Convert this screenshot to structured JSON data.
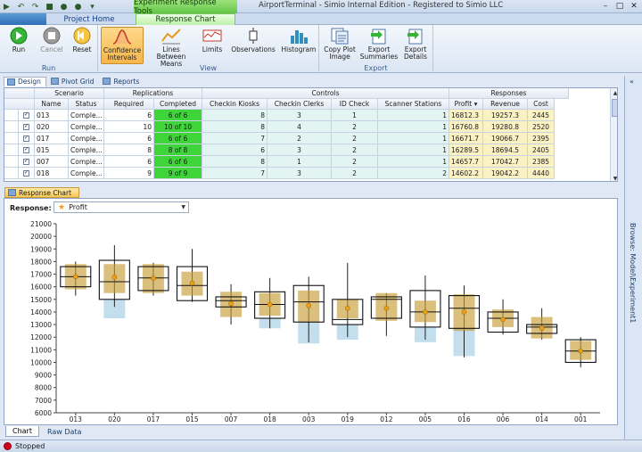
{
  "window": {
    "title": "AirportTerminal - Simio Internal Edition - Registered to Simio LLC",
    "context_tab_group": "Experiment Response Tools",
    "win_buttons": [
      "–",
      "□",
      "✕"
    ]
  },
  "ribbon_tabs": {
    "file": "",
    "project_home": "Project Home",
    "response_chart": "Response Chart"
  },
  "ribbon": {
    "run_group": {
      "label": "Run",
      "run": "Run",
      "cancel": "Cancel",
      "reset": "Reset"
    },
    "view_group": {
      "label": "View",
      "confidence": "Confidence Intervals",
      "lines": "Lines Between Means",
      "limits": "Limits",
      "observations": "Observations",
      "histogram": "Histogram"
    },
    "export_group": {
      "label": "Export",
      "copy_plot": "Copy Plot Image",
      "export_summaries": "Export Summaries",
      "export_details": "Export Details"
    }
  },
  "doc_tabs": {
    "design": "Design",
    "pivot": "Pivot Grid",
    "reports": "Reports"
  },
  "grid": {
    "group_headers": {
      "scenario": "Scenario",
      "replications": "Replications",
      "controls": "Controls",
      "responses": "Responses"
    },
    "columns": {
      "name": "Name",
      "status": "Status",
      "required": "Required",
      "completed": "Completed",
      "kiosks": "Checkin Kiosks",
      "clerks": "Checkin Clerks",
      "id_check": "ID Check",
      "scanner": "Scanner Stations",
      "profit": "Profit",
      "revenue": "Revenue",
      "cost": "Cost"
    },
    "rows": [
      {
        "name": "013",
        "status": "Comple...",
        "required": "6",
        "completed": "6 of 6",
        "kiosks": "8",
        "clerks": "3",
        "id_check": "1",
        "scanner": "1",
        "profit": "16812.3",
        "revenue": "19257.3",
        "cost": "2445"
      },
      {
        "name": "020",
        "status": "Comple...",
        "required": "10",
        "completed": "10 of 10",
        "kiosks": "8",
        "clerks": "4",
        "id_check": "2",
        "scanner": "1",
        "profit": "16760.8",
        "revenue": "19280.8",
        "cost": "2520"
      },
      {
        "name": "017",
        "status": "Comple...",
        "required": "6",
        "completed": "6 of 6",
        "kiosks": "7",
        "clerks": "2",
        "id_check": "2",
        "scanner": "1",
        "profit": "16671.7",
        "revenue": "19066.7",
        "cost": "2395"
      },
      {
        "name": "015",
        "status": "Comple...",
        "required": "8",
        "completed": "8 of 8",
        "kiosks": "6",
        "clerks": "3",
        "id_check": "2",
        "scanner": "1",
        "profit": "16289.5",
        "revenue": "18694.5",
        "cost": "2405"
      },
      {
        "name": "007",
        "status": "Comple...",
        "required": "6",
        "completed": "6 of 6",
        "kiosks": "8",
        "clerks": "1",
        "id_check": "2",
        "scanner": "1",
        "profit": "14657.7",
        "revenue": "17042.7",
        "cost": "2385"
      },
      {
        "name": "018",
        "status": "Comple...",
        "required": "9",
        "completed": "9 of 9",
        "kiosks": "7",
        "clerks": "3",
        "id_check": "2",
        "scanner": "2",
        "profit": "14602.2",
        "revenue": "19042.2",
        "cost": "4440"
      }
    ]
  },
  "chart_panel": {
    "tab": "Response Chart",
    "response_label": "Response:",
    "response_value": "Profit"
  },
  "chart_data": {
    "type": "box",
    "title": "",
    "categories": [
      "013",
      "020",
      "017",
      "015",
      "007",
      "018",
      "003",
      "019",
      "012",
      "005",
      "016",
      "006",
      "014",
      "001"
    ],
    "ylim": [
      6000,
      21000
    ],
    "yticks": [
      6000,
      7000,
      8000,
      9000,
      10000,
      11000,
      12000,
      13000,
      14000,
      15000,
      16000,
      17000,
      18000,
      19000,
      20000,
      21000
    ],
    "series": [
      {
        "items": [
          {
            "mean": 16800,
            "box": [
              16000,
              17600
            ],
            "median": 16800,
            "whisker": [
              15300,
              18000
            ],
            "ci": [
              15800,
              17800
            ],
            "low_ci": null
          },
          {
            "mean": 16760,
            "box": [
              15000,
              18100
            ],
            "median": 16400,
            "whisker": [
              14400,
              19300
            ],
            "ci": [
              15500,
              17800
            ],
            "low_ci": [
              13500,
              15000
            ]
          },
          {
            "mean": 16670,
            "box": [
              15700,
              17600
            ],
            "median": 16700,
            "whisker": [
              15300,
              17900
            ],
            "ci": [
              15500,
              17800
            ],
            "low_ci": null
          },
          {
            "mean": 16290,
            "box": [
              14900,
              17600
            ],
            "median": 16100,
            "whisker": [
              14800,
              19000
            ],
            "ci": [
              15300,
              17200
            ],
            "low_ci": null
          },
          {
            "mean": 14660,
            "box": [
              14400,
              15200
            ],
            "median": 14900,
            "whisker": [
              13000,
              16200
            ],
            "ci": [
              13600,
              15600
            ],
            "low_ci": null
          },
          {
            "mean": 14600,
            "box": [
              13500,
              15600
            ],
            "median": 14600,
            "whisker": [
              12700,
              16700
            ],
            "ci": [
              13700,
              15500
            ],
            "low_ci": [
              12700,
              13500
            ]
          },
          {
            "mean": 14500,
            "box": [
              13200,
              16100
            ],
            "median": 14800,
            "whisker": [
              11600,
              16800
            ],
            "ci": [
              13200,
              15700
            ],
            "low_ci": [
              11500,
              13200
            ]
          },
          {
            "mean": 14300,
            "box": [
              13000,
              15000
            ],
            "median": 13400,
            "whisker": [
              12000,
              17900
            ],
            "ci": [
              13500,
              15000
            ],
            "low_ci": [
              11800,
              13000
            ]
          },
          {
            "mean": 14300,
            "box": [
              13500,
              15200
            ],
            "median": 15000,
            "whisker": [
              12100,
              15500
            ],
            "ci": [
              13300,
              15500
            ],
            "low_ci": null
          },
          {
            "mean": 14000,
            "box": [
              12800,
              15700
            ],
            "median": 14000,
            "whisker": [
              11800,
              16900
            ],
            "ci": [
              13200,
              14900
            ],
            "low_ci": [
              11600,
              12800
            ]
          },
          {
            "mean": 14000,
            "box": [
              12700,
              15300
            ],
            "median": 14300,
            "whisker": [
              10400,
              16100
            ],
            "ci": [
              12500,
              15400
            ],
            "low_ci": [
              10500,
              12700
            ]
          },
          {
            "mean": 13400,
            "box": [
              12400,
              14000
            ],
            "median": 13500,
            "whisker": [
              12200,
              15000
            ],
            "ci": [
              12800,
              14200
            ],
            "low_ci": null
          },
          {
            "mean": 12700,
            "box": [
              12300,
              13000
            ],
            "median": 12800,
            "whisker": [
              11800,
              14300
            ],
            "ci": [
              11900,
              13600
            ],
            "low_ci": null
          },
          {
            "mean": 10900,
            "box": [
              10000,
              11800
            ],
            "median": 10900,
            "whisker": [
              9600,
              12000
            ],
            "ci": [
              10200,
              11700
            ],
            "low_ci": null
          }
        ]
      }
    ]
  },
  "bottom_tabs": {
    "chart": "Chart",
    "raw": "Raw Data"
  },
  "status": {
    "text": "Stopped"
  },
  "right_dock": {
    "label": "Browse: Model\\Experiment1",
    "collapse": "«"
  },
  "colors": {
    "ci_fill": "#c89c37",
    "mean_dot": "#e8a11a",
    "low_ci": "#a9d0e6",
    "completed_green": "#3ed43a"
  }
}
